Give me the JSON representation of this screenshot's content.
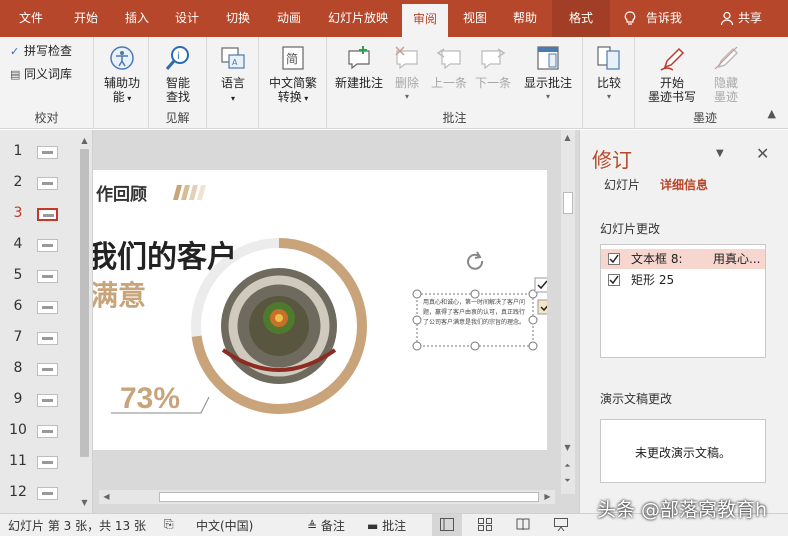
{
  "tabs": [
    {
      "label": "文件",
      "name": "tab-file"
    },
    {
      "label": "开始",
      "name": "tab-home"
    },
    {
      "label": "插入",
      "name": "tab-insert"
    },
    {
      "label": "设计",
      "name": "tab-design"
    },
    {
      "label": "切换",
      "name": "tab-transitions"
    },
    {
      "label": "动画",
      "name": "tab-animations"
    },
    {
      "label": "幻灯片放映",
      "name": "tab-slideshow"
    },
    {
      "label": "审阅",
      "name": "tab-review"
    },
    {
      "label": "视图",
      "name": "tab-view"
    },
    {
      "label": "帮助",
      "name": "tab-help"
    },
    {
      "label": "格式",
      "name": "tab-format"
    }
  ],
  "tell_me": "告诉我",
  "share": "共享",
  "ribbon": {
    "proofing": {
      "spelling": "拼写检查",
      "thesaurus": "同义词库",
      "label": "校对"
    },
    "accessibility": {
      "line1": "辅助功",
      "line2": "能",
      "label": ""
    },
    "insights": {
      "line1": "智能",
      "line2": "查找",
      "label": "见解"
    },
    "language": {
      "line1": "语言",
      "label": ""
    },
    "chinese": {
      "line1": "中文简繁",
      "line2": "转换",
      "label": ""
    },
    "comments": {
      "new": "新建批注",
      "delete": "删除",
      "previous": "上一条",
      "next": "下一条",
      "show": "显示批注",
      "label": "批注"
    },
    "compare": {
      "line1": "比较",
      "label": ""
    },
    "ink": {
      "start1": "开始",
      "start2": "墨迹书写",
      "hide1": "隐藏",
      "hide2": "墨迹",
      "label": "墨迹"
    }
  },
  "thumbnails": [
    "1",
    "2",
    "3",
    "4",
    "5",
    "6",
    "7",
    "8",
    "9",
    "10",
    "11",
    "12"
  ],
  "current_slide": 3,
  "slide": {
    "title": "作回顾",
    "heading": "我们的客户",
    "subheading": "满意",
    "percent": "73%",
    "progress": 0.73,
    "textbox": "用真心和诚心，第一时间解决了客户问题，赢得了客户由衷的认可，真正践行了公司客户满意是我们的宗旨的理念。"
  },
  "pane": {
    "title": "修订",
    "tab_slides": "幻灯片",
    "tab_details": "详细信息",
    "slide_changes": "幻灯片更改",
    "changes": [
      {
        "name": "文本框 8:",
        "detail": "用真心..."
      },
      {
        "name": "矩形 25",
        "detail": ""
      }
    ],
    "presentation_changes": "演示文稿更改",
    "no_changes": "未更改演示文稿。"
  },
  "status": {
    "slide_info": "幻灯片 第 3 张，共 13 张",
    "language": "中文(中国)",
    "notes": "备注",
    "comments": "批注"
  },
  "watermark": "头条 @部落窝教育h",
  "colors": {
    "accent": "#b7472a",
    "gold": "#c9a47a",
    "selection": "#f6d6cf"
  }
}
